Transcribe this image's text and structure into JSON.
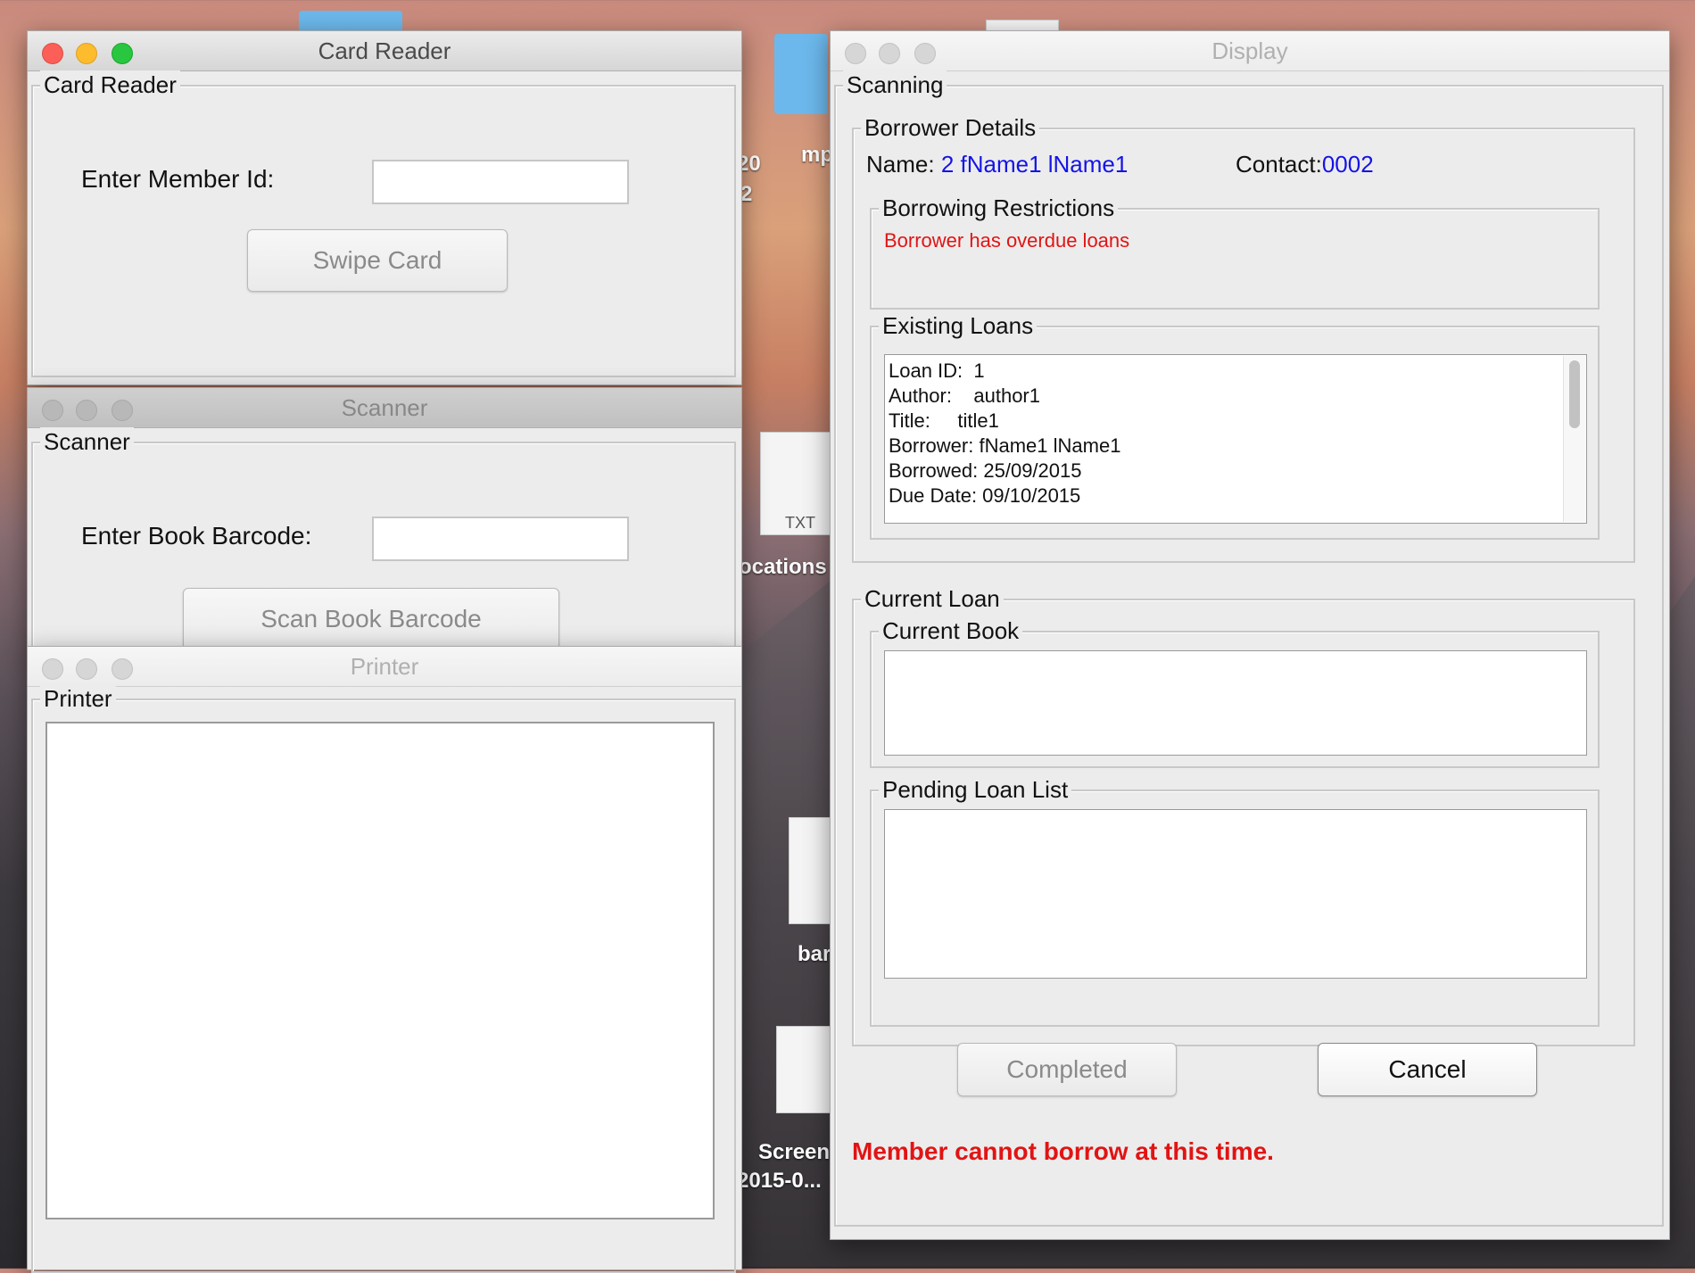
{
  "desktop": {
    "labels": [
      "20",
      "2",
      "mp",
      "ocations",
      "TXT",
      "bar",
      "Screen",
      "2015-0..."
    ]
  },
  "card_reader": {
    "title": "Card Reader",
    "group": "Card Reader",
    "member_label": "Enter Member Id:",
    "member_value": "",
    "swipe_button": "Swipe Card"
  },
  "scanner": {
    "title": "Scanner",
    "group": "Scanner",
    "barcode_label": "Enter Book Barcode:",
    "barcode_value": "",
    "scan_button": "Scan Book Barcode"
  },
  "printer": {
    "title": "Printer",
    "group": "Printer",
    "output": ""
  },
  "display": {
    "title": "Display",
    "group": "Scanning",
    "borrower": {
      "group": "Borrower Details",
      "name_label": "Name:",
      "name_value": "2 fName1 lName1",
      "contact_label": "Contact:",
      "contact_value": "0002"
    },
    "restrictions": {
      "group": "Borrowing Restrictions",
      "message": "Borrower has overdue loans"
    },
    "existing_loans": {
      "group": "Existing Loans",
      "lines": [
        "Loan ID:  1",
        "Author:    author1",
        "Title:     title1",
        "Borrower: fName1 lName1",
        "Borrowed: 25/09/2015",
        "Due Date: 09/10/2015"
      ]
    },
    "current_loan": {
      "group": "Current Loan",
      "current_book_group": "Current Book",
      "current_book_value": "",
      "pending_group": "Pending Loan List",
      "pending_value": ""
    },
    "completed_button": "Completed",
    "cancel_button": "Cancel",
    "status_message": "Member cannot borrow at this time."
  },
  "colors": {
    "link_blue": "#1414e6",
    "error_red": "#e11414",
    "window_bg": "#ececec"
  }
}
